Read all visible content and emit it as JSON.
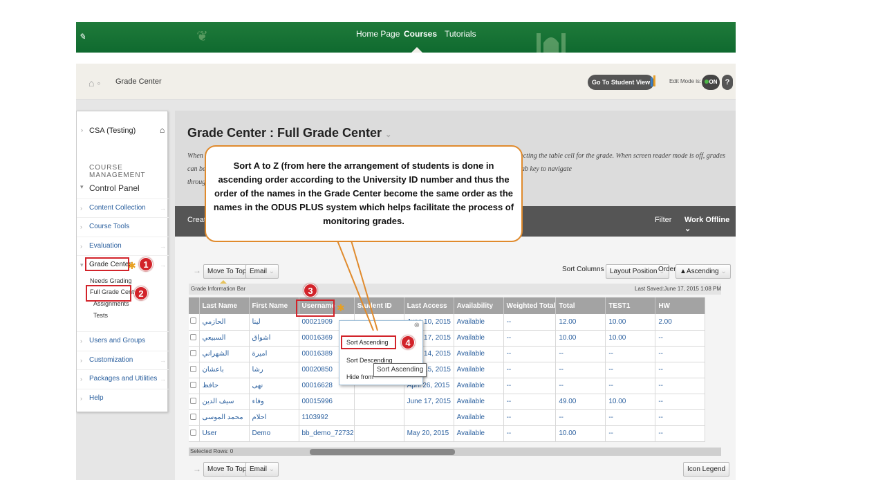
{
  "topbar": {
    "nav": [
      "Home Page",
      "Courses",
      "Tutorials"
    ]
  },
  "breadcrumb": {
    "current": "Grade Center",
    "student_view_button": "Go To Student View",
    "edit_mode_label": "Edit Mode is:",
    "edit_mode_value": "ON",
    "help": "?"
  },
  "sidebar": {
    "course": "CSA (Testing)",
    "section_title": "COURSE MANAGEMENT",
    "control_panel": "Control Panel",
    "items": [
      "Content Collection",
      "Course Tools",
      "Evaluation",
      "Grade Center",
      "Users and Groups",
      "Customization",
      "Packages and Utilities",
      "Help"
    ],
    "grade_center_sub": [
      "Needs Grading",
      "Full Grade Center",
      "Assignments",
      "Tests"
    ]
  },
  "page": {
    "title": "Grade Center : Full Grade Center",
    "description": "When screen reader mode is on the table is static and grades may be entered on the Grade Details page, accessed by selecting the table cell for the grade. When screen reader mode is off, grades can be entered directly in the table cell. After entering a grade, press the Enter key to submit. Use the arrow keys or the tab key to navigate through the table.",
    "description_lines": [
      "When screen reader mode is on the table is static and grades may be entered on the Grade Details page, accessed by selecting the table cell for the grade. When screen reader mode is off, grades",
      "can be entered directly in the table cell. After entering a grade, press the Enter key to submit. Use the arrow keys or the tab key to navigate",
      "through the table."
    ]
  },
  "action_bar": {
    "create": "Create",
    "filter": "Filter",
    "work_offline": "Work Offline"
  },
  "toolbar": {
    "move_to_top": "Move To Top",
    "email": "Email",
    "sort_columns_by": "Sort Columns By:",
    "sort_columns_value": "Layout Position",
    "order_label": "Order:",
    "order_value": "▲Ascending",
    "icon_legend": "Icon Legend"
  },
  "grade_info_bar": {
    "label": "Grade Information Bar",
    "last_saved": "Last Saved:June 17, 2015 1:08 PM"
  },
  "table": {
    "columns": [
      "Last Name",
      "First Name",
      "Username",
      "Student ID",
      "Last Access",
      "Availability",
      "Weighted Total",
      "Total",
      "TEST1",
      "HW"
    ],
    "rows": [
      [
        "الحازمي",
        "لينا",
        "00021909",
        "",
        "June 10, 2015",
        "Available",
        "--",
        "12.00",
        "10.00",
        "2.00"
      ],
      [
        "السبيعي",
        "اشواق",
        "00016369",
        "",
        "June 17, 2015",
        "Available",
        "--",
        "10.00",
        "10.00",
        "--"
      ],
      [
        "الشهراني",
        "اميرة",
        "00016389",
        "",
        "June 14, 2015",
        "Available",
        "--",
        "--",
        "--",
        "--"
      ],
      [
        "باعشان",
        "رشا",
        "00020850",
        "",
        "June 15, 2015",
        "Available",
        "--",
        "--",
        "--",
        "--"
      ],
      [
        "حافظ",
        "نهى",
        "00016628",
        "",
        "April 26, 2015",
        "Available",
        "--",
        "--",
        "--",
        "--"
      ],
      [
        "سيف الدين",
        "وفاء",
        "00015996",
        "",
        "June 17, 2015",
        "Available",
        "--",
        "49.00",
        "10.00",
        "--"
      ],
      [
        "محمد الموسى",
        "احلام",
        "1103992",
        "",
        "",
        "Available",
        "--",
        "--",
        "--",
        "--"
      ],
      [
        "User",
        "Demo",
        "bb_demo_72732",
        "",
        "May 20, 2015",
        "Available",
        "--",
        "10.00",
        "--",
        "--"
      ]
    ],
    "selected_rows": "Selected Rows: 0"
  },
  "context_menu": {
    "items": [
      "Sort Ascending",
      "Sort Descending",
      "Hide from"
    ],
    "tooltip": "Sort Ascending"
  },
  "callout": {
    "text": "Sort A to Z (from here the arrangement of students is done in ascending order according to the University ID number and thus the order of the names in the Grade Center become the same order as the names in the ODUS PLUS system which helps facilitate the process of monitoring grades."
  },
  "steps": [
    "1",
    "2",
    "3",
    "4"
  ],
  "colors": {
    "header_green": "#1f7a3a",
    "callout_border": "#e08a2c",
    "step_red": "#d2232a",
    "link_blue": "#2a5f9e"
  }
}
